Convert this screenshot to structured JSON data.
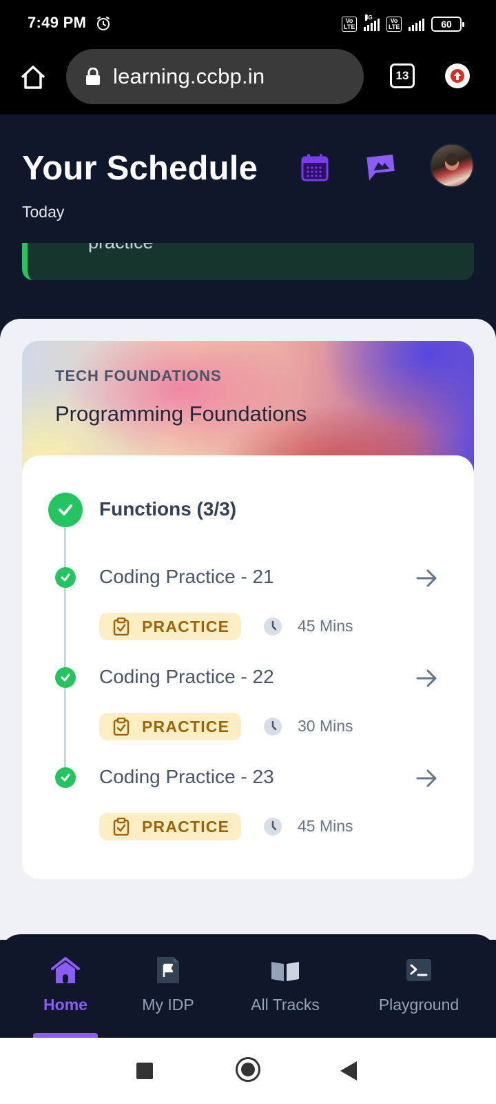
{
  "status_bar": {
    "time": "7:49 PM",
    "sim1_label": "Vo LTE",
    "network_label": "4G",
    "sim2_label": "Vo LTE",
    "battery": "60"
  },
  "browser": {
    "url": "learning.ccbp.in",
    "tab_count": "13"
  },
  "header": {
    "title": "Your Schedule",
    "subtitle": "Today",
    "previous_card_text": "practice"
  },
  "course": {
    "category": "TECH FOUNDATIONS",
    "name": "Programming Foundations",
    "module": {
      "title": "Functions (3/3)",
      "completed": true
    },
    "items": [
      {
        "title": "Coding Practice - 21",
        "badge": "PRACTICE",
        "duration": "45 Mins",
        "completed": true
      },
      {
        "title": "Coding Practice - 22",
        "badge": "PRACTICE",
        "duration": "30 Mins",
        "completed": true
      },
      {
        "title": "Coding Practice - 23",
        "badge": "PRACTICE",
        "duration": "45 Mins",
        "completed": true
      }
    ]
  },
  "bottom_nav": {
    "active": "Home",
    "items": [
      {
        "label": "Home",
        "icon": "home-icon"
      },
      {
        "label": "My IDP",
        "icon": "flag-document-icon"
      },
      {
        "label": "All Tracks",
        "icon": "book-icon"
      },
      {
        "label": "Playground",
        "icon": "terminal-icon"
      }
    ]
  },
  "colors": {
    "accent": "#8b5cf6",
    "success": "#22c55e",
    "dark_bg": "#0f172a",
    "badge_bg": "#fdefc3",
    "badge_text": "#a16207"
  }
}
